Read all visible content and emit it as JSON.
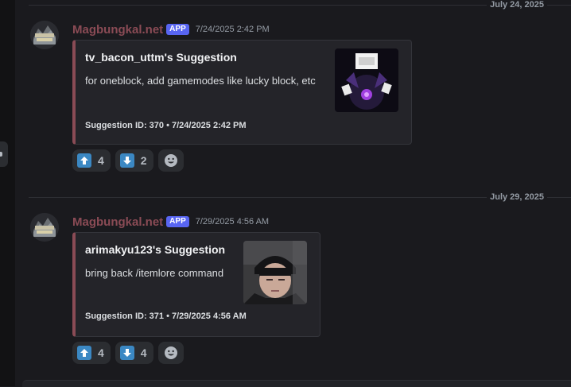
{
  "dividers": [
    {
      "date": "July 24, 2025"
    },
    {
      "date": "July 29, 2025"
    }
  ],
  "messages": [
    {
      "username": "Magbungkal.net",
      "badge": "APP",
      "timestamp": "7/24/2025 2:42 PM",
      "embed": {
        "title": "tv_bacon_uttm's Suggestion",
        "description": "for oneblock, add gamemodes like lucky block, etc",
        "footer": "Suggestion ID: 370 • 7/24/2025 2:42 PM"
      },
      "reactions": [
        {
          "icon": "up-arrow-icon",
          "count": "4"
        },
        {
          "icon": "down-arrow-icon",
          "count": "2"
        }
      ]
    },
    {
      "username": "Magbungkal.net",
      "badge": "APP",
      "timestamp": "7/29/2025 4:56 AM",
      "embed": {
        "title": "arimakyu123's Suggestion",
        "description": "bring back /itemlore command",
        "footer": "Suggestion ID: 371 • 7/29/2025 4:56 AM"
      },
      "reactions": [
        {
          "icon": "up-arrow-icon",
          "count": "4"
        },
        {
          "icon": "down-arrow-icon",
          "count": "4"
        }
      ]
    }
  ],
  "colors": {
    "accent": "#8a4b55",
    "badge": "#5865f2",
    "reaction_icon": "#3b88c3"
  }
}
